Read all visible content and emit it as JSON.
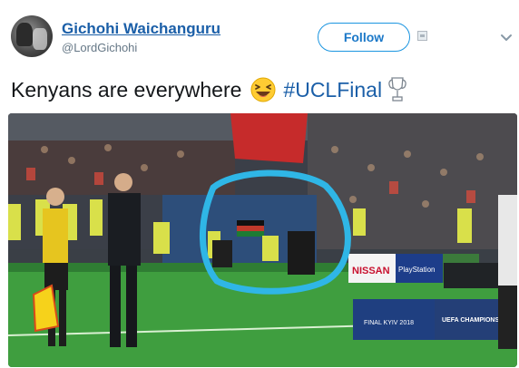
{
  "author": {
    "display_name": "Gichohi Waichanguru",
    "handle": "@LordGichohi"
  },
  "actions": {
    "follow_label": "Follow"
  },
  "tweet": {
    "text": "Kenyans are everywhere",
    "emoji": "laughing-squinting-face",
    "hashtag": "#UCLFinal",
    "hashtag_icon": "champions-league-trophy-icon"
  },
  "media": {
    "ad_boards": [
      "NISSAN",
      "PlayStation",
      "FINAL KYIV 2018",
      "UEFA CHAMPIONS"
    ],
    "annotation_color": "#2fb6e6"
  },
  "colors": {
    "link": "#1b5fa8",
    "accent": "#1b95e0",
    "muted": "#657786"
  }
}
